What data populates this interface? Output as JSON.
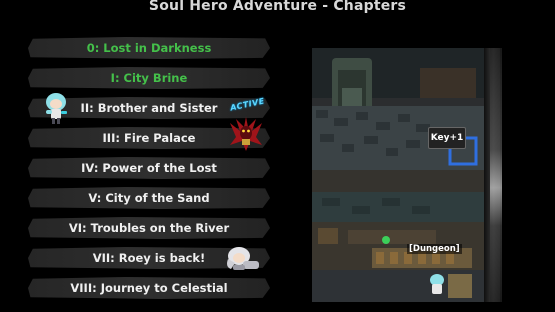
{
  "screen": {
    "title": "Soul Hero Adventure - Chapters"
  },
  "chapters": [
    {
      "label": "0: Lost in Darkness",
      "color": "#44c04a"
    },
    {
      "label": "I: City Brine",
      "color": "#44c04a"
    },
    {
      "label": "II: Brother and Sister",
      "color": "#f0f0f0"
    },
    {
      "label": "III: Fire Palace",
      "color": "#f0f0f0"
    },
    {
      "label": "IV: Power of the Lost",
      "color": "#f0f0f0"
    },
    {
      "label": "V: City of the Sand",
      "color": "#f0f0f0"
    },
    {
      "label": "VI: Troubles on the River",
      "color": "#f0f0f0"
    },
    {
      "label": "VII: Roey is back!",
      "color": "#f0f0f0"
    },
    {
      "label": "VIII: Journey to Celestial",
      "color": "#f0f0f0"
    }
  ],
  "badges": {
    "active": "Active"
  },
  "map_preview": {
    "key_label": "Key+1",
    "location_label": "[Dungeon]"
  },
  "icons": {
    "hero": "hero-sprite-icon",
    "fire_boss": "fire-demon-icon",
    "roey": "roey-sprite-icon"
  }
}
